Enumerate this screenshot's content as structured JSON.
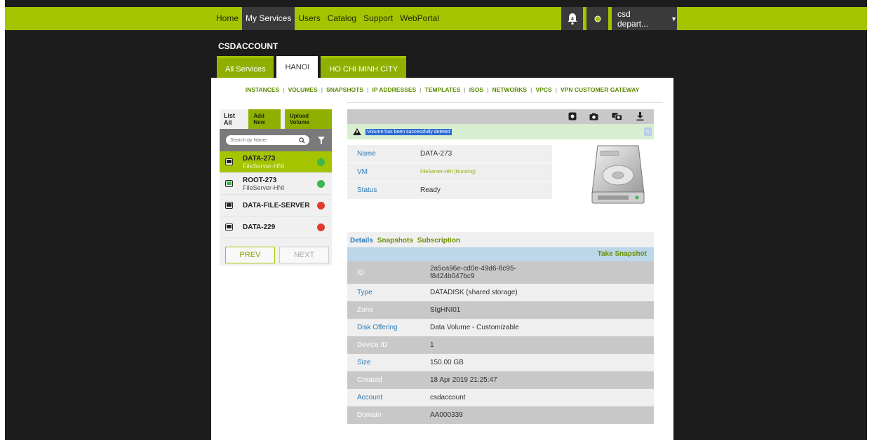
{
  "topnav": {
    "items": [
      "Home",
      "My Services",
      "Users",
      "Catalog",
      "Support",
      "WebPortal"
    ],
    "active_index": 1,
    "notification_count": "4",
    "user_label": "csd depart..."
  },
  "account": {
    "title": "CSDACCOUNT"
  },
  "region_tabs": [
    "All Services",
    "HANOI",
    "HO CHI MINH CITY"
  ],
  "subnav": [
    "INSTANCES",
    "VOLUMES",
    "SNAPSHOTS",
    "IP ADDRESSES",
    "TEMPLATES",
    "ISOS",
    "NETWORKS",
    "VPCS",
    "VPN CUSTOMER GATEWAY"
  ],
  "list": {
    "list_all": "List All",
    "add_new": "Add New",
    "upload_volume": "Upload Volume",
    "search_placeholder": "Search by Name",
    "items": [
      {
        "name": "DATA-273",
        "sub": "FileServer-HNI",
        "status": "green"
      },
      {
        "name": "ROOT-273",
        "sub": "FileServer-HNI",
        "status": "green"
      },
      {
        "name": "DATA-FILE-SERVER",
        "sub": "",
        "status": "red"
      },
      {
        "name": "DATA-229",
        "sub": "",
        "status": "red"
      }
    ],
    "prev": "PREV",
    "next": "NEXT"
  },
  "alert": {
    "message": "Volume has been successfully deleted",
    "close": "×"
  },
  "summary": {
    "name_label": "Name",
    "name_value": "DATA-273",
    "vm_label": "VM",
    "vm_value": "FileServer-HNI (Running)",
    "status_label": "Status",
    "status_value": "Ready"
  },
  "detail_tabs": [
    "Details",
    "Snapshots",
    "Subscription"
  ],
  "take_snapshot": "Take Snapshot",
  "details": [
    {
      "label": "ID",
      "value": "2a5ca96e-cd0e-49d6-8c95-f8424b047bc9"
    },
    {
      "label": "Type",
      "value": "DATADISK (shared storage)"
    },
    {
      "label": "Zone",
      "value": "StgHNI01"
    },
    {
      "label": "Disk Offering",
      "value": "Data Volume - Customizable"
    },
    {
      "label": "Device ID",
      "value": "1"
    },
    {
      "label": "Size",
      "value": "150.00 GB"
    },
    {
      "label": "Created",
      "value": "18 Apr 2019 21:25:47"
    },
    {
      "label": "Account",
      "value": "csdaccount"
    },
    {
      "label": "Domain",
      "value": "AA000339"
    }
  ],
  "colors": {
    "accent": "#a4c400",
    "link": "#2b7bb9",
    "dark": "#3a3a3a"
  }
}
